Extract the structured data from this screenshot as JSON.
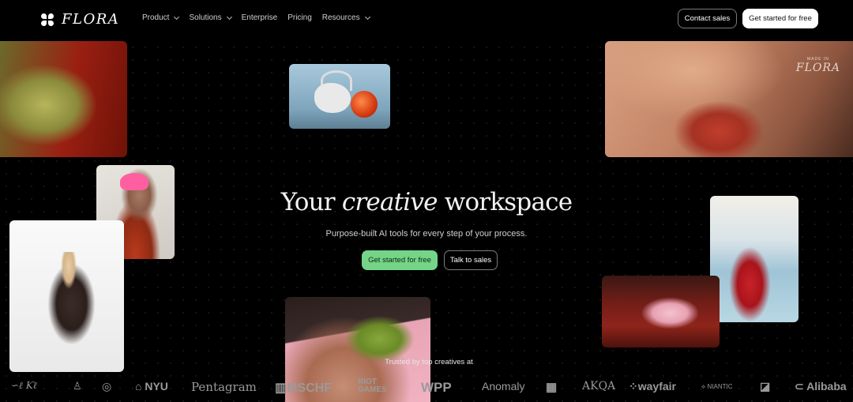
{
  "nav": {
    "brand": "FLORA",
    "menu": [
      {
        "label": "Product",
        "dropdown": true
      },
      {
        "label": "Solutions",
        "dropdown": true
      },
      {
        "label": "Enterprise",
        "dropdown": false
      },
      {
        "label": "Pricing",
        "dropdown": false
      },
      {
        "label": "Resources",
        "dropdown": true
      }
    ],
    "contact_label": "Contact sales",
    "start_label": "Get started for free"
  },
  "hero": {
    "title_pre": "Your ",
    "title_em": "creative",
    "title_post": " workspace",
    "subtitle": "Purpose-built AI tools for every step of your process.",
    "cta_primary": "Get started for free",
    "cta_secondary": "Talk to sales"
  },
  "watermark": {
    "small": "MADE IN",
    "brand": "FLORA"
  },
  "trusted": "Trusted by top creatives at",
  "logos": [
    "NYU",
    "Pentagram",
    "MSCHF",
    "RIOT GAMES",
    "WPP",
    "Anomaly",
    "AKQA",
    "wayfair",
    "NIANTIC",
    "Alibaba"
  ],
  "colors": {
    "background": "#000000",
    "accent_green": "#74d487",
    "text": "#ffffff"
  }
}
